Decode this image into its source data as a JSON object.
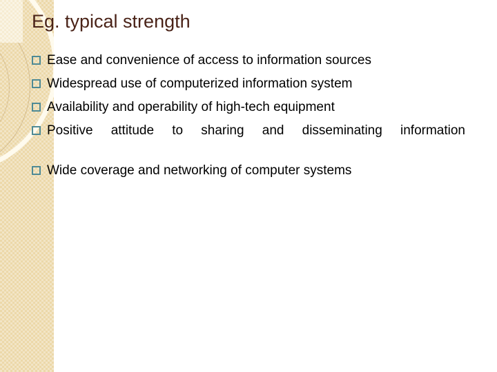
{
  "slide": {
    "title": "Eg. typical strength",
    "title_color": "#4a2318",
    "background_color": "#ffffff",
    "band_color": "#ecd8a9",
    "bullet_marker_color": "#4e8a95",
    "body_text_color": "#000000",
    "bullet_marker_icon": "hollow-square-bullet-icon",
    "bullets": [
      {
        "text": "Ease and convenience of access to information sources",
        "justified": false
      },
      {
        "text": "Widespread use of computerized information system",
        "justified": false
      },
      {
        "text": "Availability and operability of high-tech equipment",
        "justified": false
      },
      {
        "text": "Positive attitude to sharing and disseminating information",
        "justified": true
      },
      {
        "text": "Wide coverage and networking of computer systems",
        "justified": false
      }
    ]
  }
}
